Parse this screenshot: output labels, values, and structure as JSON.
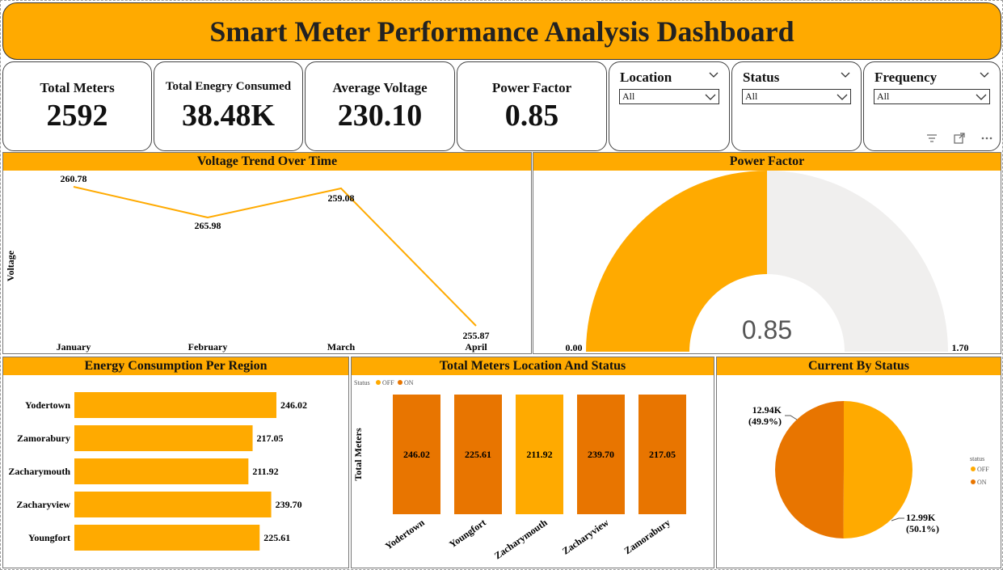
{
  "header": {
    "title": "Smart Meter Performance Analysis Dashboard"
  },
  "kpis": [
    {
      "label": "Total Meters",
      "value": "2592"
    },
    {
      "label": "Total Enegry Consumed",
      "value": "38.48K"
    },
    {
      "label": "Average Voltage",
      "value": "230.10"
    },
    {
      "label": "Power Factor",
      "value": "0.85"
    }
  ],
  "slicers": [
    {
      "title": "Location",
      "value": "All"
    },
    {
      "title": "Status",
      "value": "All"
    },
    {
      "title": "Frequency",
      "value": "All"
    }
  ],
  "colors": {
    "accent": "#FFAA00",
    "on": "#E87500",
    "off": "#FFAA00",
    "gauge_track": "#F0EFEE"
  },
  "chart_data": [
    {
      "type": "line",
      "title": "Voltage Trend Over Time",
      "ylabel": "Voltage",
      "categories": [
        "January",
        "February",
        "March",
        "April"
      ],
      "values": [
        260.78,
        265.98,
        259.08,
        255.87
      ],
      "labels": [
        "260.78",
        "265.98",
        "259.08",
        "255.87"
      ]
    },
    {
      "type": "gauge",
      "title": "Power Factor",
      "value": 0.85,
      "value_label": "0.85",
      "min": 0,
      "max": 1.7,
      "min_label": "0.00",
      "max_label": "1.70"
    },
    {
      "type": "bar",
      "orientation": "horizontal",
      "title": "Energy Consumption Per Region",
      "categories": [
        "Yodertown",
        "Zamorabury",
        "Zacharymouth",
        "Zacharyview",
        "Youngfort"
      ],
      "values": [
        246.02,
        217.05,
        211.92,
        239.7,
        225.61
      ],
      "labels": [
        "246.02",
        "217.05",
        "211.92",
        "239.70",
        "225.61"
      ]
    },
    {
      "type": "bar",
      "title": "Total Meters Location And Status",
      "ylabel": "Total Meters",
      "legend_title": "Status",
      "legend": [
        "OFF",
        "ON"
      ],
      "categories": [
        "Yodertown",
        "Youngfort",
        "Zacharymouth",
        "Zacharyview",
        "Zamorabury"
      ],
      "values": [
        246.02,
        225.61,
        211.92,
        239.7,
        217.05
      ],
      "labels": [
        "246.02",
        "225.61",
        "211.92",
        "239.70",
        "217.05"
      ],
      "status": [
        "ON",
        "ON",
        "OFF",
        "ON",
        "ON"
      ]
    },
    {
      "type": "pie",
      "title": "Current By Status",
      "legend_title": "status",
      "legend": [
        "OFF",
        "ON"
      ],
      "slices": [
        {
          "name": "OFF",
          "value": 12.99,
          "label": "12.99K",
          "pct": "(50.1%)"
        },
        {
          "name": "ON",
          "value": 12.94,
          "label": "12.94K",
          "pct": "(49.9%)"
        }
      ]
    }
  ]
}
